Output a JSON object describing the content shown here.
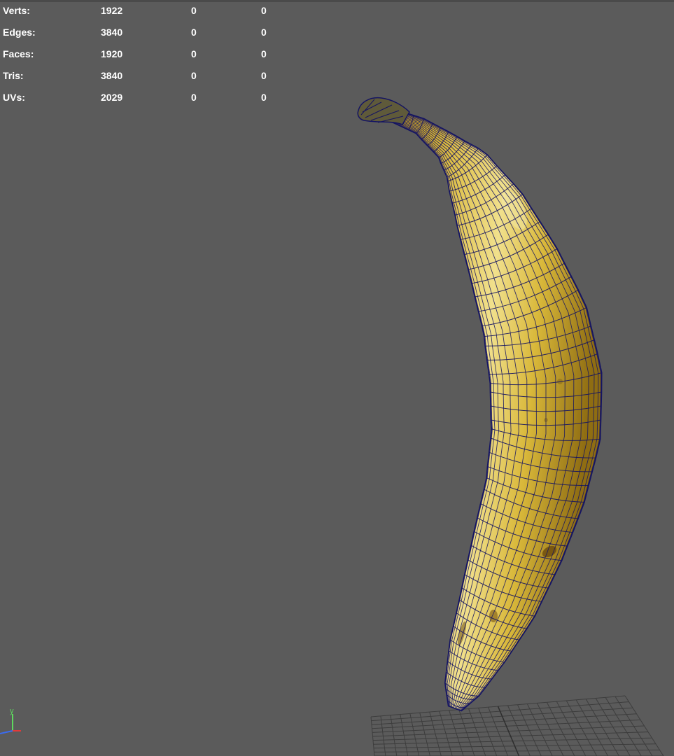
{
  "viewport": {
    "background": "#5b5b5b"
  },
  "hud": {
    "rows": [
      {
        "label": "Verts:",
        "values": [
          "1922",
          "0",
          "0"
        ]
      },
      {
        "label": "Edges:",
        "values": [
          "3840",
          "0",
          "0"
        ]
      },
      {
        "label": "Faces:",
        "values": [
          "1920",
          "0",
          "0"
        ]
      },
      {
        "label": "Tris:",
        "values": [
          "3840",
          "0",
          "0"
        ]
      },
      {
        "label": "UVs:",
        "values": [
          "2029",
          "0",
          "0"
        ]
      }
    ]
  },
  "axis": {
    "up_label": "y",
    "colors": {
      "x": "#e23a3a",
      "y": "#5ed85e",
      "z": "#3b6cf0"
    }
  },
  "model": {
    "colors": {
      "peel": "#d9b735",
      "peel_highlight": "#f0df86",
      "peel_shadow": "#8f6d12",
      "wireframe": "#141463",
      "ground_grid": "#3d3d3d"
    }
  }
}
